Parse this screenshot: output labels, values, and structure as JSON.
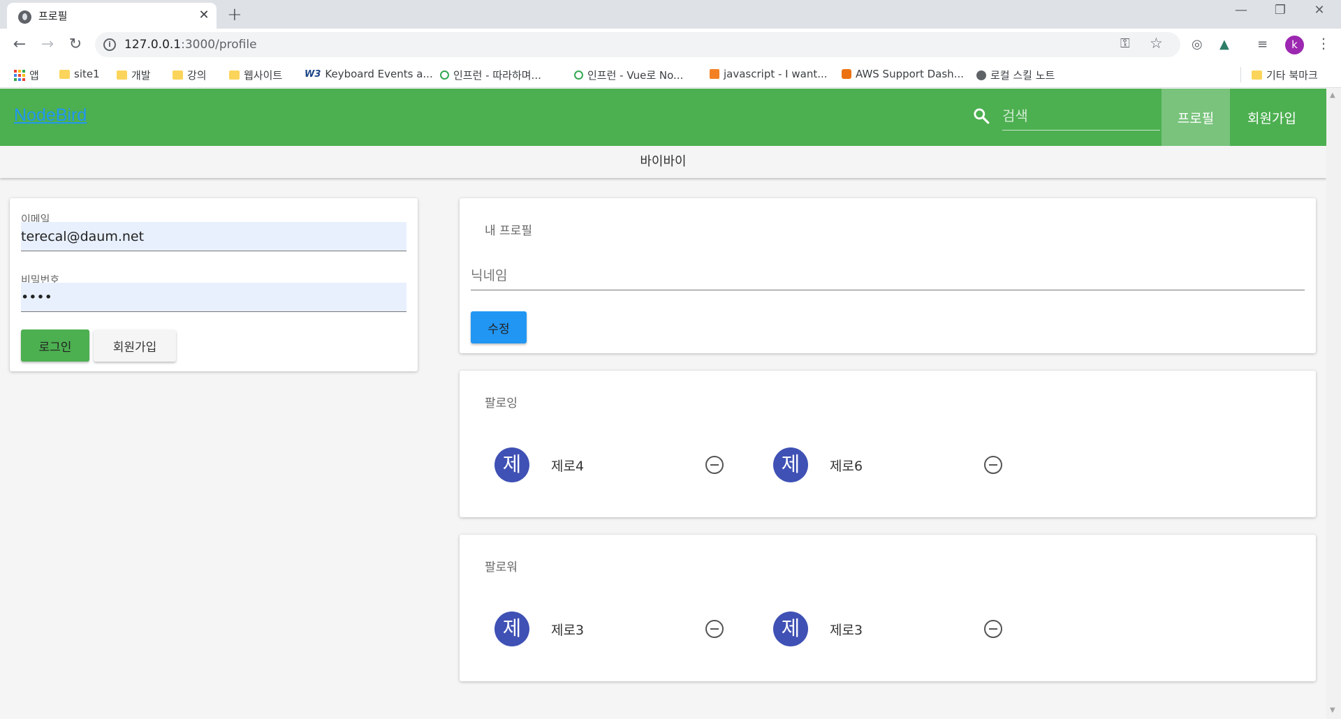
{
  "browser": {
    "tab_title": "프로필",
    "tab_close": "✕",
    "new_tab": "+",
    "url_host": "127.0.0.1",
    "url_path": ":3000/profile",
    "profile_initial": "k",
    "bookmarks": [
      {
        "label": "앱",
        "icon": "apps-grid-icon"
      },
      {
        "label": "site1",
        "icon": "folder-icon"
      },
      {
        "label": "개발",
        "icon": "folder-icon"
      },
      {
        "label": "강의",
        "icon": "folder-icon"
      },
      {
        "label": "웹사이트",
        "icon": "folder-icon"
      },
      {
        "label": "Keyboard Events a...",
        "icon": "w3schools-icon"
      },
      {
        "label": "인프런 - 따라하며...",
        "icon": "inflearn-icon"
      },
      {
        "label": "인프런 - Vue로 No...",
        "icon": "inflearn-icon"
      },
      {
        "label": "javascript - I want...",
        "icon": "stackoverflow-icon"
      },
      {
        "label": "AWS Support Dash...",
        "icon": "aws-icon"
      },
      {
        "label": "로컬 스킬 노트",
        "icon": "globe-icon"
      },
      {
        "label": "기타 북마크",
        "icon": "folder-icon"
      }
    ]
  },
  "app": {
    "brand": "NodeBird",
    "search_placeholder": "검색",
    "nav_profile": "프로필",
    "nav_signup": "회원가입",
    "subbar_text": "바이바이",
    "colors": {
      "appbar": "#4caf50",
      "avatar": "#3f51b5",
      "edit_button": "#2196f3"
    }
  },
  "login": {
    "email_label": "이메일",
    "email_value": "terecal@daum.net",
    "password_label": "비밀번호",
    "password_value": "1234",
    "login_button": "로그인",
    "signup_button": "회원가입"
  },
  "profile": {
    "title": "내 프로필",
    "nickname_placeholder": "닉네임",
    "edit_button": "수정"
  },
  "following": {
    "title": "팔로잉",
    "people": [
      {
        "avatar": "제",
        "name": "제로4"
      },
      {
        "avatar": "제",
        "name": "제로6"
      }
    ]
  },
  "followers": {
    "title": "팔로워",
    "people": [
      {
        "avatar": "제",
        "name": "제로3"
      },
      {
        "avatar": "제",
        "name": "제로3"
      }
    ]
  }
}
